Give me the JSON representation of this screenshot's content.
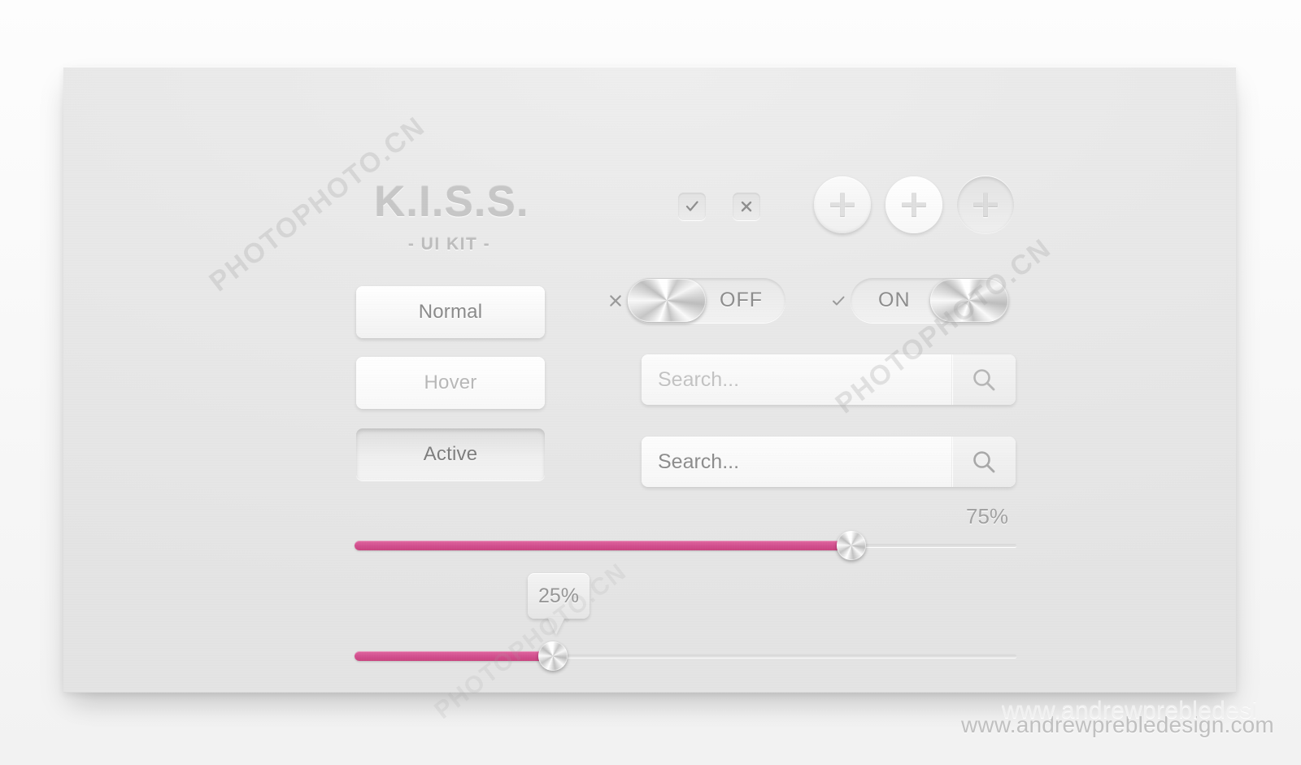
{
  "brand": {
    "title": "K.I.S.S.",
    "subtitle": "- UI KIT -"
  },
  "checkboxes": [
    {
      "name": "checkbox-checked",
      "icon": "check-icon",
      "state": "checked"
    },
    {
      "name": "checkbox-crossed",
      "icon": "close-icon",
      "state": "crossed"
    }
  ],
  "round_buttons": [
    {
      "name": "add-button-normal",
      "icon": "plus-icon",
      "state": "normal"
    },
    {
      "name": "add-button-hover",
      "icon": "plus-icon",
      "state": "hover"
    },
    {
      "name": "add-button-active",
      "icon": "plus-icon",
      "state": "active"
    }
  ],
  "state_buttons": [
    {
      "label": "Normal",
      "state": "normal"
    },
    {
      "label": "Hover",
      "state": "hover"
    },
    {
      "label": "Active",
      "state": "active"
    }
  ],
  "toggles": [
    {
      "mark_icon": "close-icon",
      "label": "OFF",
      "value": "off"
    },
    {
      "mark_icon": "check-icon",
      "label": "ON",
      "value": "on"
    }
  ],
  "search_fields": [
    {
      "placeholder": "Search...",
      "value": "",
      "state": "default",
      "button_icon": "search-icon"
    },
    {
      "placeholder": "Search...",
      "value": "",
      "state": "focused",
      "button_icon": "search-icon"
    }
  ],
  "sliders": [
    {
      "label": "75%",
      "value": 75,
      "label_position": "above-right",
      "knob_icon": "slider-knob"
    },
    {
      "label": "25%",
      "value": 25,
      "label_position": "tooltip",
      "knob_icon": "slider-knob"
    }
  ],
  "footer": {
    "url": "www.andrewprebledesign.com"
  },
  "page_watermark": "www.andrewprebledesi",
  "watermarks": [
    "PHOTOPHOTO.CN",
    "PHOTOPHOTO.CN",
    "PHOTOPHOTO.CN"
  ],
  "colors": {
    "accent_pink": "#d24e8e",
    "card_background": "#e9e9e9",
    "text_primary": "#8b8b8b",
    "text_muted": "#c3c3c3"
  }
}
